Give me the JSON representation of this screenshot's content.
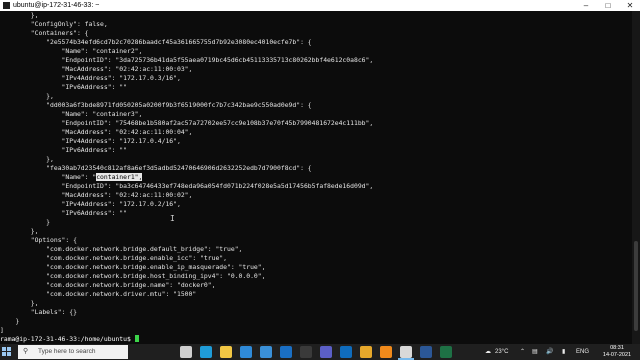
{
  "window": {
    "title": "ubuntu@ip-172-31-46-33: ~"
  },
  "terminal": {
    "lines": [
      "        },",
      "        \"ConfigOnly\": false,",
      "        \"Containers\": {",
      "            \"2e5574b34efd6cd7b2c70286baadcf45a361665755d7b92e3080ec4010ecfe7b\": {",
      "                \"Name\": \"container2\",",
      "                \"EndpointID\": \"3da725736b41da5f55aea0719bc45d6cb45113335713c80262bbf4e612c0a8c6\",",
      "                \"MacAddress\": \"02:42:ac:11:00:03\",",
      "                \"IPv4Address\": \"172.17.0.3/16\",",
      "                \"IPv6Address\": \"\"",
      "            },",
      "            \"dd003a6f3bde8971fd050205a0200f9b3f6519000fc7b7c342bae9c550ad0e9d\": {",
      "                \"Name\": \"container3\",",
      "                \"EndpointID\": \"75468be1b580af2ac57a72702ee57cc9e108b37e70f45b7990481672e4c111bb\",",
      "                \"MacAddress\": \"02:42:ac:11:00:04\",",
      "                \"IPv4Address\": \"172.17.0.4/16\",",
      "                \"IPv6Address\": \"\"",
      "            },",
      "            \"fea30ab7d23540c812af8a6ef3d5adbd52470646906d2632252edb7d7900f8cd\": {",
      "                \"Name\": \"container1\",",
      "                \"EndpointID\": \"ba3c64746433ef748eda96a054fd071b224f028e5a5d17456b5faf8ede16d09d\",",
      "                \"MacAddress\": \"02:42:ac:11:00:02\",",
      "                \"IPv4Address\": \"172.17.0.2/16\",",
      "                \"IPv6Address\": \"\"",
      "            }",
      "        },",
      "        \"Options\": {",
      "            \"com.docker.network.bridge.default_bridge\": \"true\",",
      "            \"com.docker.network.bridge.enable_icc\": \"true\",",
      "            \"com.docker.network.bridge.enable_ip_masquerade\": \"true\",",
      "            \"com.docker.network.bridge.host_binding_ipv4\": \"0.0.0.0\",",
      "            \"com.docker.network.bridge.name\": \"docker0\",",
      "            \"com.docker.network.driver.mtu\": \"1500\"",
      "        },",
      "        \"Labels\": {}",
      "    }",
      "]"
    ],
    "highlight": {
      "before": "                \"Name\": \"",
      "selected": "container1\",",
      "after": ""
    },
    "prompt": "rama@ip-172-31-46-33:/home/ubuntu$ "
  },
  "taskbar": {
    "search_placeholder": "Type here to search",
    "weather": "23°C",
    "language": "ENG",
    "time": "08:31",
    "date": "14-07-2021",
    "icons": [
      {
        "name": "task-view-icon",
        "color": "#cfcfcf"
      },
      {
        "name": "edge-browser-icon",
        "color": "#1f9cd8"
      },
      {
        "name": "file-explorer-icon",
        "color": "#f2c744"
      },
      {
        "name": "mail-icon",
        "color": "#2f8ad8"
      },
      {
        "name": "store-icon",
        "color": "#3a90d8"
      },
      {
        "name": "photos-icon",
        "color": "#1a6fc4"
      },
      {
        "name": "terminal-icon",
        "color": "#3a3a3a"
      },
      {
        "name": "teams-icon",
        "color": "#5b5fc7"
      },
      {
        "name": "outlook-icon",
        "color": "#0f6cbd"
      },
      {
        "name": "chrome-icon",
        "color": "#e7a82b"
      },
      {
        "name": "vlc-icon",
        "color": "#f08a1b"
      },
      {
        "name": "terminal-active-icon",
        "color": "#d9d9d9"
      },
      {
        "name": "word-icon",
        "color": "#2b5797"
      },
      {
        "name": "excel-icon",
        "color": "#1e7145"
      }
    ]
  }
}
